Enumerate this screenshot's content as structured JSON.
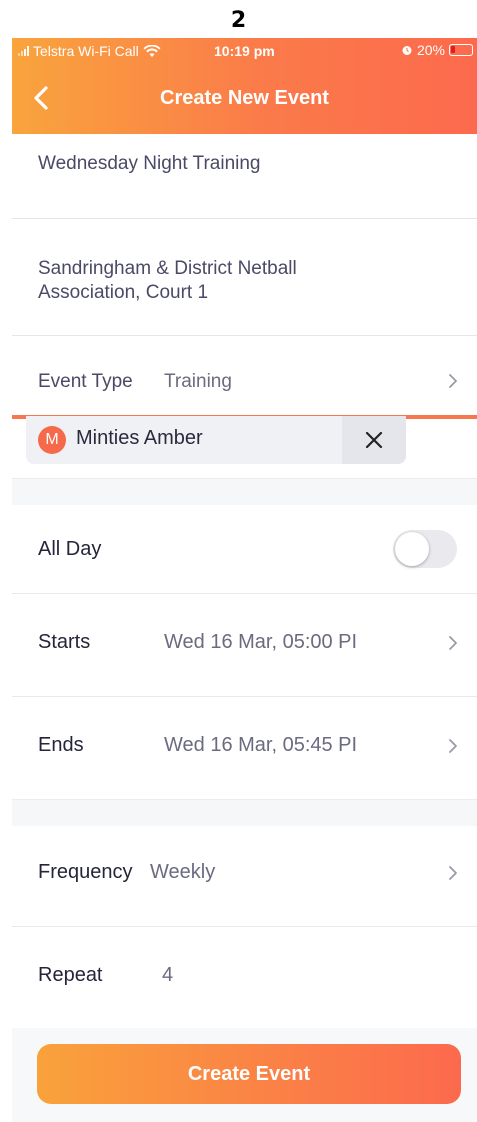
{
  "page_number": "2",
  "status_bar": {
    "carrier": "Telstra Wi-Fi Call",
    "time": "10:19 pm",
    "battery": "20%"
  },
  "header": {
    "title": "Create New Event"
  },
  "event": {
    "name": "Wednesday Night Training",
    "location_line1": "Sandringham & District Netball",
    "location_line2": "Association, Court 1",
    "type_label": "Event Type",
    "type_value": "Training"
  },
  "team_chip": {
    "initial": "M",
    "name": "Minties Amber"
  },
  "schedule": {
    "all_day_label": "All Day",
    "all_day_on": false,
    "starts_label": "Starts",
    "starts_value": "Wed 16 Mar, 05:00 PI",
    "ends_label": "Ends",
    "ends_value": "Wed 16 Mar, 05:45 PI"
  },
  "recurrence": {
    "frequency_label": "Frequency",
    "frequency_value": "Weekly",
    "repeat_label": "Repeat",
    "repeat_value": "4"
  },
  "actions": {
    "create_label": "Create Event"
  },
  "colors": {
    "accent_start": "#f9a43d",
    "accent_end": "#fc6a4d",
    "avatar": "#f56a4b"
  }
}
